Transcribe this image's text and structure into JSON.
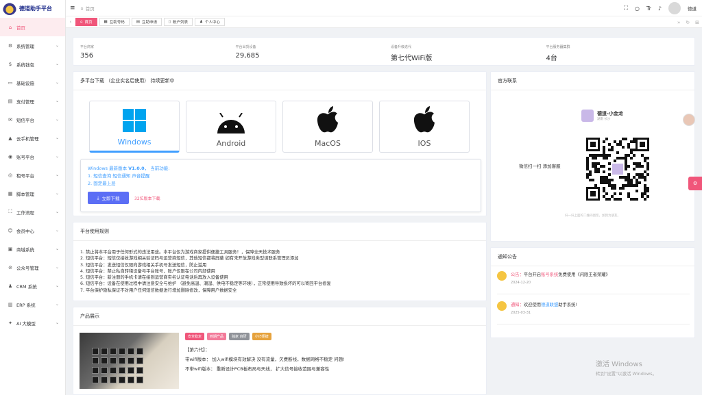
{
  "app": {
    "title": "德道助手平台"
  },
  "sidebar": {
    "items": [
      {
        "label": "首页",
        "icon": "home-icon",
        "glyph": "⌂",
        "active": true,
        "chev": false
      },
      {
        "label": "系统管理",
        "icon": "gear-icon",
        "glyph": "⚙",
        "chev": true
      },
      {
        "label": "系统钱包",
        "icon": "dollar-icon",
        "glyph": "$",
        "chev": true
      },
      {
        "label": "基础设施",
        "icon": "monitor-icon",
        "glyph": "▭",
        "chev": true
      },
      {
        "label": "支付管理",
        "icon": "payment-icon",
        "glyph": "▤",
        "chev": true
      },
      {
        "label": "短信平台",
        "icon": "chat-icon",
        "glyph": "✉",
        "chev": true
      },
      {
        "label": "云手机管理",
        "icon": "android-icon",
        "glyph": "▲",
        "chev": true
      },
      {
        "label": "账号平台",
        "icon": "wechat-icon",
        "glyph": "◉",
        "chev": true
      },
      {
        "label": "租号平台",
        "icon": "eye-icon",
        "glyph": "◎",
        "chev": true
      },
      {
        "label": "脚本管理",
        "icon": "script-icon",
        "glyph": "▦",
        "chev": true
      },
      {
        "label": "工作流程",
        "icon": "workflow-icon",
        "glyph": "⛶",
        "chev": true
      },
      {
        "label": "会员中心",
        "icon": "member-icon",
        "glyph": "☺",
        "chev": true
      },
      {
        "label": "商城系统",
        "icon": "shop-icon",
        "glyph": "▣",
        "chev": true
      },
      {
        "label": "公众号管理",
        "icon": "official-account-icon",
        "glyph": "⊘",
        "chev": true
      },
      {
        "label": "CRM 系统",
        "icon": "user-icon",
        "glyph": "♟",
        "chev": true
      },
      {
        "label": "ERP 系统",
        "icon": "erp-icon",
        "glyph": "▥",
        "chev": true
      },
      {
        "label": "AI 大模型",
        "icon": "ai-icon",
        "glyph": "✦",
        "chev": true
      }
    ]
  },
  "header": {
    "breadcrumb": "首页",
    "username": "德道"
  },
  "tabs": [
    {
      "label": "首页",
      "icon": "home-icon",
      "glyph": "⌂",
      "active": true
    },
    {
      "label": "互助号码",
      "icon": "grid-icon",
      "glyph": "▦"
    },
    {
      "label": "互助申请",
      "icon": "form-icon",
      "glyph": "▤"
    },
    {
      "label": "帐户列表",
      "icon": "doc-icon",
      "glyph": "▯"
    },
    {
      "label": "个人中心",
      "icon": "user-icon",
      "glyph": "♟"
    }
  ],
  "stats": [
    {
      "label": "平台商家",
      "value": "356"
    },
    {
      "label": "平台出货设备",
      "value": "29,685"
    },
    {
      "label": "设备升级迭代",
      "value": "第七代WiFi版"
    },
    {
      "label": "平台服务器集群",
      "value": "4台"
    }
  ],
  "download": {
    "title": "多平台下载 （企业实名后使用） 持续更新中",
    "platforms": [
      "Windows",
      "Android",
      "MacOS",
      "IOS"
    ],
    "version_prefix": "Windows 最新版本",
    "version": "V1.0.0",
    "version_suffix": "， 当前功能:",
    "features": [
      "1. 短信查询 短信通知 声音提醒",
      "2. 固定最上层"
    ],
    "button": "立即下载",
    "count": "32位版本下载"
  },
  "rules": {
    "title": "平台使用规则",
    "lines": [
      "1. 禁止将本平台用于任何形式的违法用途。本平台仅为游戏商家提供便捷工具服务！，保障全天技术服务",
      "2. 短信平台：短信仅接收游戏相关验证码与运营商短信，其他短信都将屏蔽 如有未开放游戏类型请联系管理员添加",
      "3. 短信平台：发送短信仅限向游戏相关手机号发送短信，防止滥用",
      "4. 短信平台：禁止私自转租设备与平台账号，账户仅限在公司内部使用",
      "5. 短信平台：新注册的手机卡请在接到运营商实名认证电话后再放入设备使用",
      "6. 短信平台：设备在使用过程中请注意安全与维护 （避免高温、潮湿、供电不稳定等环境），正常使用导致损坏的可以寄回平台修复",
      "7. 平台保护隐私保证不对用户任何短信数据进行增加删除修改，保障用户数据安全"
    ]
  },
  "product": {
    "title": "产品展示",
    "tags": [
      {
        "label": "安全稳定",
        "color": "#f0567a"
      },
      {
        "label": "到期产品",
        "color": "#f37b9a"
      },
      {
        "label": "独家 自研",
        "color": "#909399"
      },
      {
        "label": "小巧便捷",
        "color": "#e6a23c"
      }
    ],
    "gen": "【第六代】：",
    "lines": [
      "带wifi版本： 加入wifi模块有效解决 没有流量，欠费断线，数据网络不稳定 问题!",
      "不带wifi版本： 重新设计PCB板布局与天线， 扩大信号接收范围与兼容性"
    ]
  },
  "contact": {
    "title": "官方联系",
    "name": "德道-小金龙",
    "sub": "湖南 长沙",
    "scan": "微信扫一扫 添加客服",
    "note": "扫一扫上面的二维码图案，加我为朋友。"
  },
  "notice": {
    "title": "通知公告",
    "items": [
      {
        "prefix": "公告：",
        "text1": "平台开启",
        "link": "账号系统",
        "text2": "免费使用《闪限王者荣耀》",
        "date": "2024-12-20"
      },
      {
        "prefix": "通知：",
        "text1": "欢迎使用",
        "link": "德道联盟",
        "text2": "助手系统!",
        "date": "2025-03-31"
      }
    ]
  },
  "watermark": {
    "line1": "激活 Windows",
    "line2": "转到\"设置\"以激活 Windows。"
  }
}
